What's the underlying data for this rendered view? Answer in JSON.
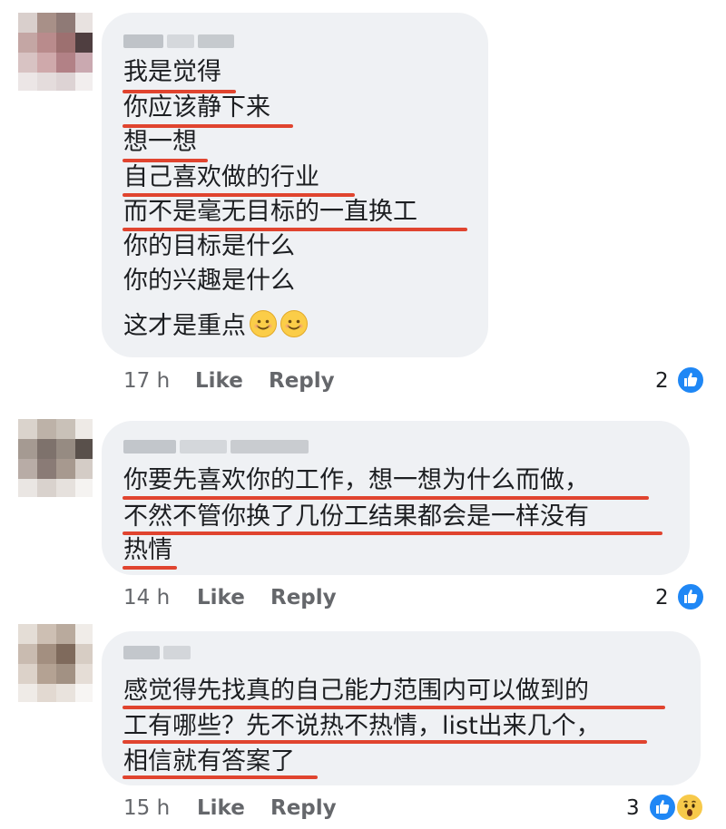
{
  "comments": [
    {
      "lines": [
        "我是觉得",
        "你应该静下来",
        "想一想",
        "自己喜欢做的行业",
        "而不是毫无目标的一直换工",
        "你的目标是什么",
        "你的兴趣是什么",
        "这才是重点"
      ],
      "emoji": [
        "smiling-face-emoji",
        "smiling-face-emoji"
      ],
      "time": "17 h",
      "like_label": "Like",
      "reply_label": "Reply",
      "reaction_count": "2",
      "reactions": [
        "like-icon"
      ]
    },
    {
      "lines": [
        "你要先喜欢你的工作，想一想为什么而做，",
        "不然不管你换了几份工结果都会是一样没有",
        "热情"
      ],
      "time": "14 h",
      "like_label": "Like",
      "reply_label": "Reply",
      "reaction_count": "2",
      "reactions": [
        "like-icon"
      ]
    },
    {
      "lines": [
        "感觉得先找真的自己能力范围内可以做到的",
        "工有哪些？先不说热不热情，list出来几个，",
        "相信就有答案了"
      ],
      "time": "15 h",
      "like_label": "Like",
      "reply_label": "Reply",
      "reaction_count": "3",
      "reactions": [
        "like-icon",
        "wow-icon"
      ]
    }
  ],
  "colors": {
    "bubble": "#eff1f4",
    "underline": "#e0442f",
    "meta_text": "#65676b",
    "like_blue": "#1f87f5"
  }
}
